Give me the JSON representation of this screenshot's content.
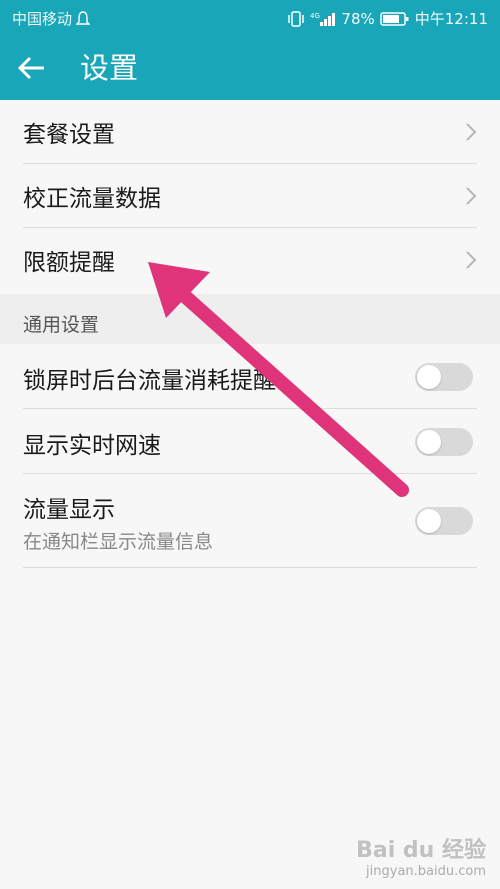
{
  "status_bar": {
    "carrier": "中国移动",
    "battery": "78%",
    "time": "中午12:11"
  },
  "app_bar": {
    "back_icon": "arrow-left-icon",
    "title": "设置"
  },
  "main_list": {
    "items": [
      {
        "label": "套餐设置",
        "icon": "chevron-right-icon"
      },
      {
        "label": "校正流量数据",
        "icon": "chevron-right-icon"
      },
      {
        "label": "限额提醒",
        "icon": "chevron-right-icon"
      }
    ]
  },
  "general_section": {
    "header": "通用设置",
    "items": [
      {
        "label": "锁屏时后台流量消耗提醒",
        "toggle": "off"
      },
      {
        "label": "显示实时网速",
        "toggle": "off"
      },
      {
        "label": "流量显示",
        "subtitle": "在通知栏显示流量信息",
        "toggle": "off"
      }
    ]
  },
  "annotation": {
    "arrow_color": "#e0347a"
  },
  "watermark": {
    "brand": "Bai du 经验",
    "url": "jingyan.baidu.com"
  },
  "colors": {
    "accent": "#19a6b8",
    "toggle_off": "#d9d9d9"
  }
}
